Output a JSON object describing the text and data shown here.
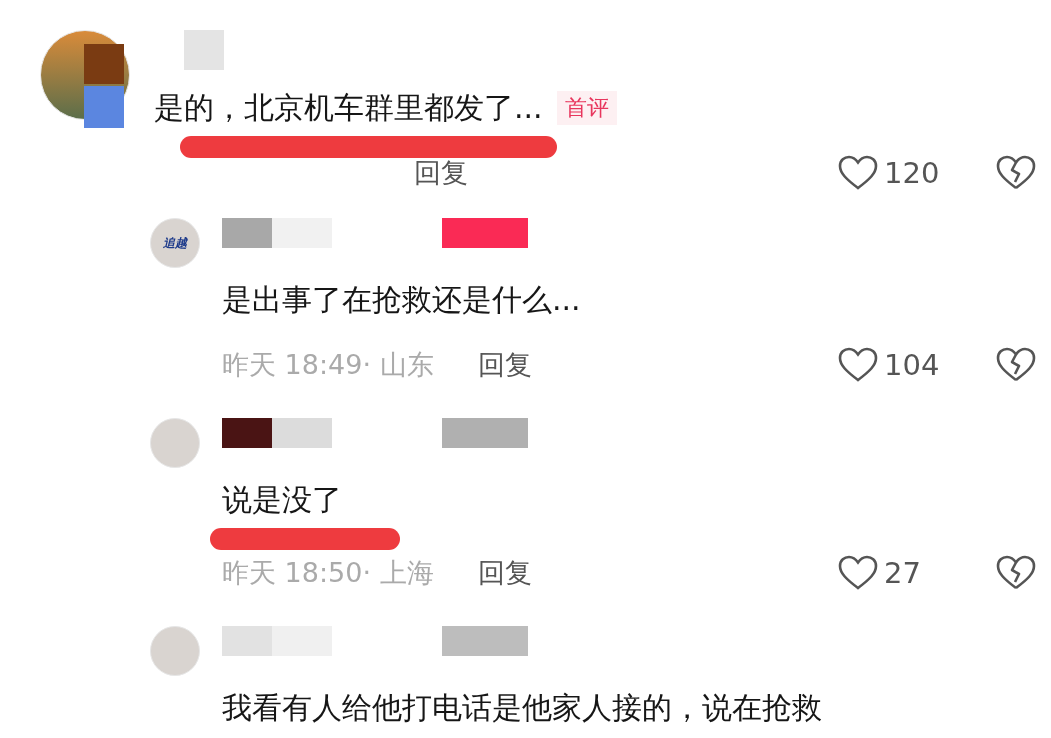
{
  "comments": [
    {
      "kind": "top",
      "name_blocks": [
        {
          "color": "#7a3b12"
        },
        {
          "color": "#5b86e0"
        },
        {
          "color": "#e4e4e4"
        }
      ],
      "text": "是的，北京机车群里都发了...",
      "badge": "首评",
      "underlined": true,
      "reply": "回复",
      "likes": "120"
    },
    {
      "kind": "reply",
      "logo": "追越",
      "name_blocks": [
        {
          "color": "#a8a8a8"
        },
        {
          "color": "#f1f1f1"
        },
        {
          "color": "#fa2a55"
        }
      ],
      "text": "是出事了在抢救还是什么...",
      "underlined": false,
      "time": "昨天 18:49· 山东",
      "reply": "回复",
      "likes": "104"
    },
    {
      "kind": "reply",
      "name_blocks": [
        {
          "color": "#4a1414"
        },
        {
          "color": "#dcdcdc"
        },
        {
          "color": "#b0b0b0"
        }
      ],
      "text": "说是没了",
      "underlined": true,
      "time": "昨天 18:50· 上海",
      "reply": "回复",
      "likes": "27"
    },
    {
      "kind": "reply",
      "name_blocks": [
        {
          "color": "#e2e2e2"
        },
        {
          "color": "#f0f0f0"
        },
        {
          "color": "#bdbdbd"
        }
      ],
      "text": "我看有人给他打电话是他家人接的，说在抢救",
      "underlined": false
    }
  ]
}
